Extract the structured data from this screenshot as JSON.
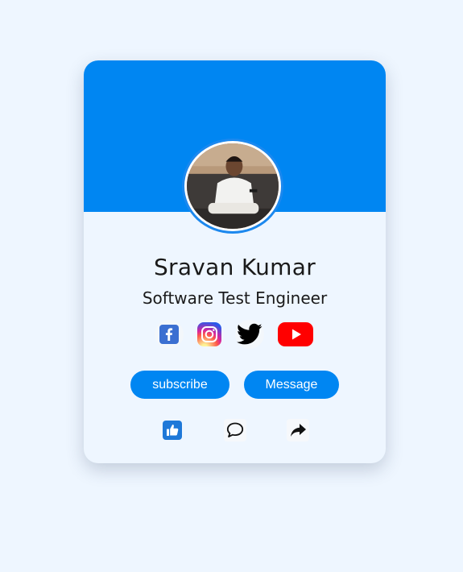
{
  "profile": {
    "name": "Sravan Kumar",
    "role": "Software Test Engineer",
    "avatar_icon": "profile-photo"
  },
  "socials": [
    {
      "icon": "facebook-icon",
      "color": "#3b6fd1"
    },
    {
      "icon": "instagram-icon",
      "color": "#d6249f"
    },
    {
      "icon": "twitter-icon",
      "color": "#000000"
    },
    {
      "icon": "youtube-icon",
      "color": "#ff0000"
    }
  ],
  "buttons": {
    "subscribe": "subscribe",
    "message": "Message"
  },
  "actions": [
    {
      "icon": "thumbs-up-icon"
    },
    {
      "icon": "comment-icon"
    },
    {
      "icon": "share-icon"
    }
  ],
  "colors": {
    "accent": "#0086f2",
    "background": "#eef6ff"
  }
}
